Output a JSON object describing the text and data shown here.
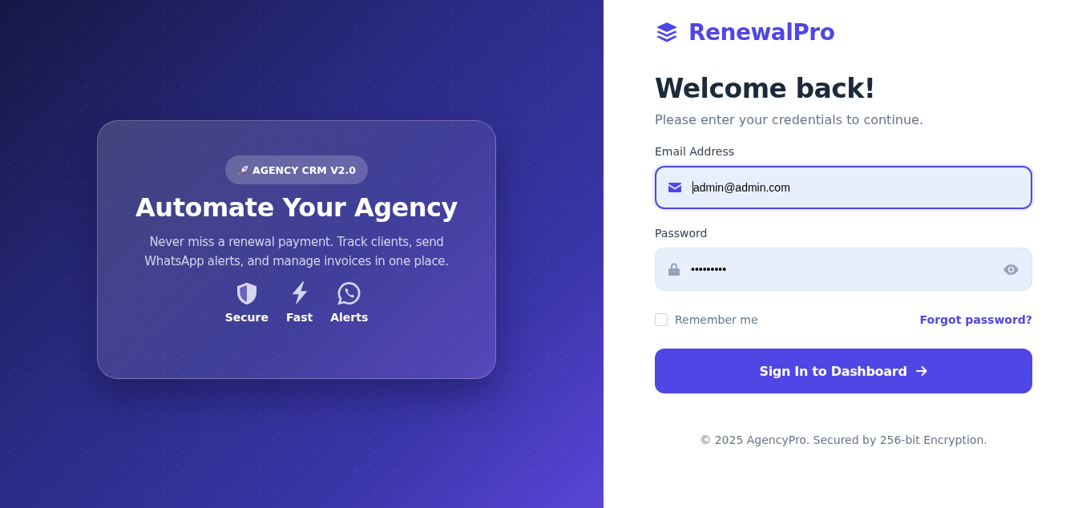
{
  "hero": {
    "badge": "AGENCY CRM V2.0",
    "title": "Automate Your Agency",
    "text": "Never miss a renewal payment. Track clients, send WhatsApp alerts, and manage invoices in one place.",
    "features": [
      {
        "kind": "shield",
        "label": "Secure"
      },
      {
        "kind": "bolt",
        "label": "Fast"
      },
      {
        "kind": "chat",
        "label": "Alerts"
      }
    ]
  },
  "brand": "RenewalPro",
  "heading": "Welcome back!",
  "subheading": "Please enter your credentials to continue.",
  "fields": [
    {
      "kind": "email",
      "label": "Email Address",
      "value": "admin@admin.com",
      "focused": true
    },
    {
      "kind": "password",
      "label": "Password",
      "value": "•••••••••",
      "focused": false
    }
  ],
  "remember": {
    "label": "Remember me",
    "checked": false
  },
  "forgot": "Forgot password?",
  "submit": "Sign In to Dashboard",
  "footer": "© 2025 AgencyPro. Secured by 256-bit Encryption."
}
